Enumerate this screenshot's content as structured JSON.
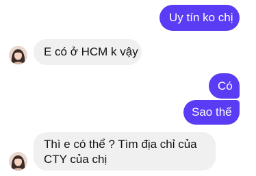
{
  "conversation": {
    "messages": [
      {
        "sender": "self",
        "text": "Uy tín ko chị"
      },
      {
        "sender": "contact",
        "text": "E có ở HCM k vậy"
      },
      {
        "sender": "self",
        "text": "Có"
      },
      {
        "sender": "self",
        "text": "Sao thế"
      },
      {
        "sender": "contact",
        "lines": [
          "Thì e có thể ? Tìm địa chỉ của",
          "CTY của chị"
        ]
      }
    ]
  },
  "colors": {
    "outgoing_bubble": "#5b3cf5",
    "incoming_bubble": "#f0f0f0",
    "background": "#ffffff"
  },
  "icons": {
    "contact_avatar": "contact-avatar-photo"
  }
}
